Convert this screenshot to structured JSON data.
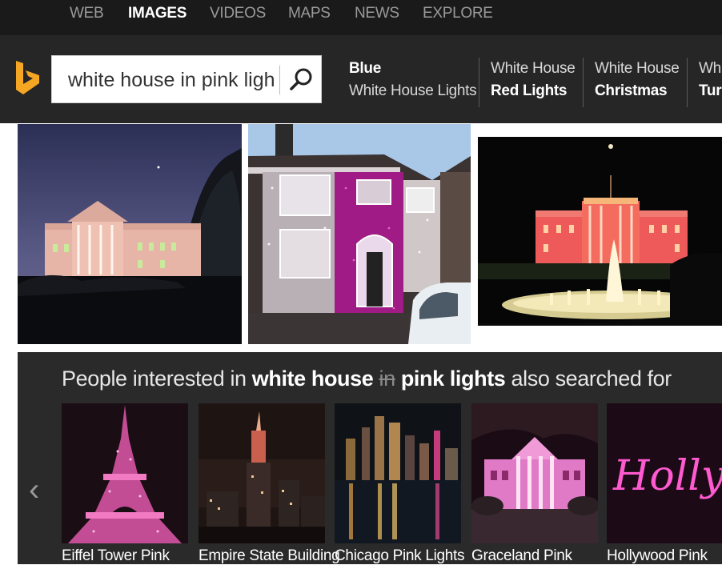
{
  "nav": {
    "tabs": [
      {
        "label": "WEB",
        "active": false
      },
      {
        "label": "IMAGES",
        "active": true
      },
      {
        "label": "VIDEOS",
        "active": false
      },
      {
        "label": "MAPS",
        "active": false
      },
      {
        "label": "NEWS",
        "active": false
      },
      {
        "label": "EXPLORE",
        "active": false
      }
    ]
  },
  "search": {
    "query": "white house in pink lights",
    "icon": "search-icon",
    "logo": "bing-logo"
  },
  "related": [
    {
      "line1": "Blue",
      "line2": "White House Lights",
      "bold_line": 1
    },
    {
      "line1": "White House",
      "line2": "Red Lights",
      "bold_line": 2
    },
    {
      "line1": "White House",
      "line2": "Christmas",
      "bold_line": 2
    },
    {
      "line1": "Whi",
      "line2": "Tur",
      "bold_line": 2
    }
  ],
  "people": {
    "prefix": "People interested in ",
    "term1": "white house",
    "struck": "in",
    "term2": "pink lights",
    "suffix": " also searched for",
    "prev_icon": "chevron-left-icon",
    "items": [
      {
        "caption": "Eiffel Tower Pink"
      },
      {
        "caption": "Empire State Building"
      },
      {
        "caption": "Chicago Pink Lights"
      },
      {
        "caption": "Graceland Pink"
      },
      {
        "caption": "Hollywood Pink"
      }
    ],
    "hollywood_sign_text": "Hollyw"
  },
  "colors": {
    "nav_bg": "#1a1a1a",
    "header_bg": "#262626",
    "logo": "#f5a623",
    "panel_bg": "#2a2a2a"
  }
}
